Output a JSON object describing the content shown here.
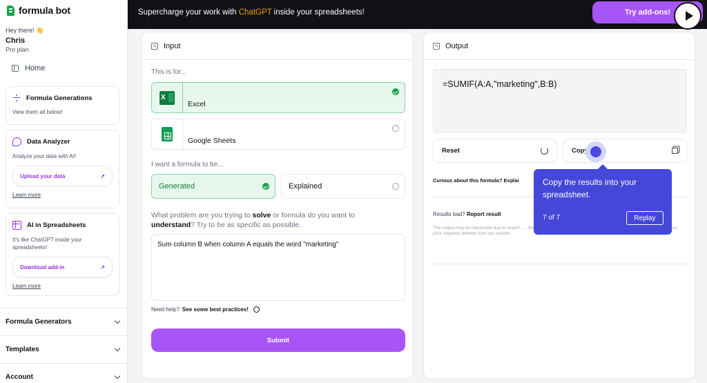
{
  "brand": {
    "name": "formula bot"
  },
  "user": {
    "greeting": "Hey there! 👋",
    "name": "Chris",
    "plan": "Pro plan"
  },
  "sidebar": {
    "home": "Home",
    "cards": [
      {
        "title": "Formula Generations",
        "desc": "View them all below!"
      },
      {
        "title": "Data Analyzer",
        "desc": "Analyze your data with AI!",
        "button": "Upload your data",
        "learn": "Learn more"
      },
      {
        "title": "AI in Spreadsheets",
        "desc": "It's like ChatGPT inside your spreadsheets!",
        "button": "Download add-in",
        "learn": "Learn more"
      }
    ],
    "sections": [
      "Formula Generators",
      "Templates",
      "Account"
    ]
  },
  "banner": {
    "text_before": "Supercharge your work with ",
    "highlight": "ChatGPT",
    "text_after": " inside your spreadsheets!",
    "button": "Try add-ons!"
  },
  "input": {
    "title": "Input",
    "for_label": "This is for...",
    "for_options": [
      {
        "label": "Excel",
        "selected": true
      },
      {
        "label": "Google Sheets",
        "selected": false
      }
    ],
    "formula_label": "I want a formula to be...",
    "mode_options": [
      {
        "label": "Generated",
        "selected": true
      },
      {
        "label": "Explained",
        "selected": false
      }
    ],
    "question_a": "What problem are you trying to ",
    "question_b": "solve",
    "question_c": " or formula do you want to ",
    "question_d": "understand",
    "question_e": "? Try to be as specific as possible.",
    "text_value": "Sum column B when column A equals the word \"marketing\"",
    "help_a": "Need help?",
    "help_b": "See some best practices!",
    "submit": "Submit"
  },
  "output": {
    "title": "Output",
    "formula": "=SUMIF(A:A,\"marketing\",B:B)",
    "reset": "Reset",
    "copy": "Copy",
    "curious_a": "Curious about this formula?",
    "curious_b": "Explai",
    "bad_a": "Results bad?",
    "bad_b": "Report result",
    "disclaimer": "The output may be inaccurate due to imperf... ...ting to use in production. Contact hello@formulabot... ...you would like your prior requests deleted from our system."
  },
  "tooltip": {
    "text": "Copy the results into your spreadsheet.",
    "step": "7 of 7",
    "button": "Replay"
  },
  "colors": {
    "accent": "#a855f7",
    "selected_bg": "#e8f7ee",
    "tooltip_bg": "#4447d8",
    "banner_bg": "#0f1115"
  }
}
